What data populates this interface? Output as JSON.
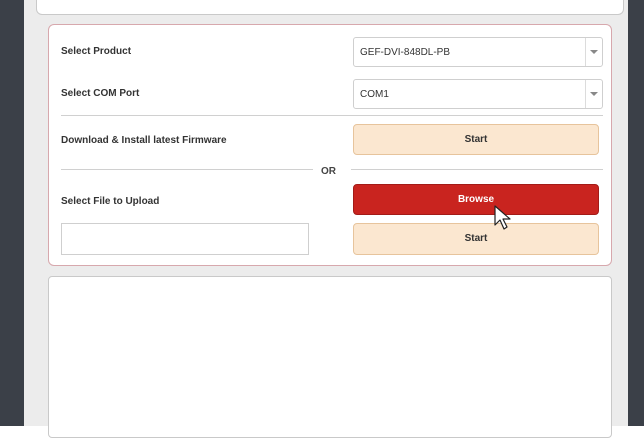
{
  "form": {
    "product_label": "Select Product",
    "product_value": "GEF-DVI-848DL-PB",
    "com_port_label": "Select COM Port",
    "com_port_value": "COM1",
    "download_label": "Download & Install latest Firmware",
    "download_button": "Start",
    "or_text": "OR",
    "file_label": "Select File to Upload",
    "file_value": "",
    "browse_button": "Browse",
    "upload_button": "Start"
  },
  "log": {
    "text": ""
  },
  "colors": {
    "accent_red": "#c9241f",
    "start_bg": "#fbe7d0",
    "panel_border": "#d7a8ad",
    "window_frame": "#3b4048"
  }
}
